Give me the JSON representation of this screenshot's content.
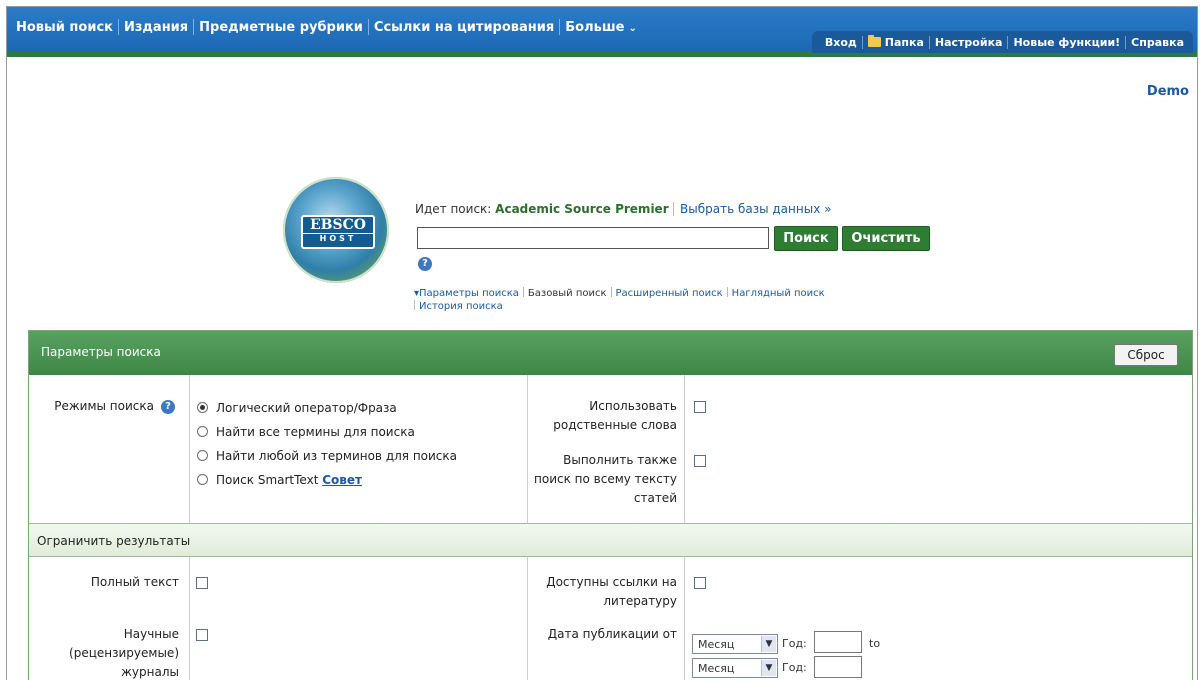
{
  "nav": {
    "main": [
      "Новый поиск",
      "Издания",
      "Предметные рубрики",
      "Ссылки на цитирования",
      "Больше"
    ],
    "more_chevron": "⌄",
    "utility": [
      "Вход",
      "Папка",
      "Настройка",
      "Новые функции!",
      "Справка"
    ]
  },
  "user": {
    "name": "Demo"
  },
  "logo": {
    "text": "EBSCO",
    "sub": "HOST"
  },
  "search": {
    "searching_label": "Идет поиск:",
    "database": "Academic Source Premier",
    "choose_db": "Выбрать базы данных »",
    "input_value": "",
    "search_button": "Поиск",
    "clear_button": "Очистить",
    "help_glyph": "?",
    "links": {
      "options": "Параметры поиска",
      "basic": "Базовый поиск",
      "advanced": "Расширенный поиск",
      "visual": "Наглядный поиск",
      "history": "История поиска"
    }
  },
  "options_panel": {
    "title": "Параметры поиска",
    "reset": "Сброс",
    "modes_label": "Режимы поиска",
    "modes": [
      {
        "label": "Логический оператор/Фраза",
        "selected": true
      },
      {
        "label": "Найти все термины для поиска",
        "selected": false
      },
      {
        "label": "Найти любой из терминов для поиска",
        "selected": false
      },
      {
        "label": "Поиск SmartText",
        "selected": false
      }
    ],
    "smarttext_tip": "Совет",
    "related_words_label": "Использовать родственные слова",
    "fulltext_search_label": "Выполнить также поиск по всему тексту статей"
  },
  "limits": {
    "title": "Ограничить результаты",
    "full_text_label": "Полный текст",
    "references_label": "Доступны ссылки на литературу",
    "peer_reviewed_label": "Научные (рецензируемые) журналы",
    "pub_date_label": "Дата публикации от",
    "month_placeholder": "Месяц",
    "year_label": "Год:",
    "to_label": "to"
  }
}
